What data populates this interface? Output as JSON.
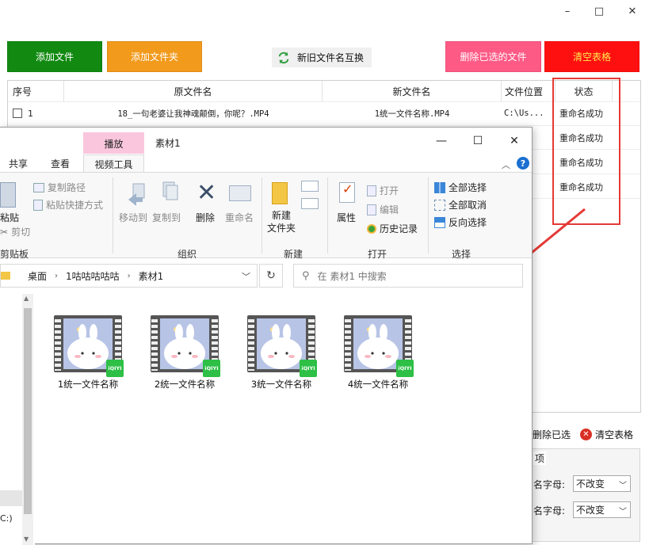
{
  "app": {
    "window_controls": {
      "minimize": "–",
      "maximize": "□",
      "close": "✕"
    },
    "toolbar": {
      "add_file": "添加文件",
      "add_folder": "添加文件夹",
      "swap_names": "新旧文件名互换",
      "delete_selected": "删除已选的文件",
      "clear_table": "清空表格"
    },
    "colors": {
      "add_file": "#128a12",
      "add_folder": "#f29a1c",
      "delete_selected": "#fe5a86",
      "clear_table": "#ff1010",
      "highlight": "#e53935",
      "arrow": "#e53935"
    },
    "table": {
      "headers": [
        "序号",
        "原文件名",
        "新文件名",
        "文件位置",
        "状态"
      ],
      "rows": [
        {
          "index": "1",
          "old_name": "18_一句老婆让我神魂颠倒，你呢？.MP4",
          "new_name": "1统一文件名称.MP4",
          "location": "C:\\Us...",
          "status": "重命名成功"
        },
        {
          "index": "",
          "old_name": "",
          "new_name": "",
          "location": "",
          "status": "重命名成功"
        },
        {
          "index": "",
          "old_name": "",
          "new_name": "",
          "location": "",
          "status": "重命名成功"
        },
        {
          "index": "",
          "old_name": "",
          "new_name": "",
          "location": "",
          "status": "重命名成功"
        }
      ]
    },
    "bottom": {
      "delete_selected": "删除已选",
      "clear_table": "清空表格",
      "options_title": "项",
      "option1_label": "名字母:",
      "option1_value": "不改变",
      "option2_label": "名字母:",
      "option2_value": "不改变"
    }
  },
  "explorer": {
    "title": "素材1",
    "contextual_tab_header": "播放",
    "tabs": [
      "共享",
      "查看",
      "视频工具"
    ],
    "window_controls": {
      "minimize": "—",
      "maximize": "☐",
      "close": "✕"
    },
    "ribbon": {
      "paste": "粘贴",
      "copy_path": "复制路径",
      "paste_shortcut": "粘贴快捷方式",
      "cut": "剪切",
      "clipboard_group": "剪贴板",
      "move_to": "移动到",
      "copy_to": "复制到",
      "delete": "删除",
      "rename": "重命名",
      "organize_group": "组织",
      "new_folder": "新建\n文件夹",
      "new_folder_line1": "新建",
      "new_folder_line2": "文件夹",
      "new_group": "新建",
      "properties": "属性",
      "open": "打开",
      "edit": "编辑",
      "history": "历史记录",
      "open_group": "打开",
      "select_all": "全部选择",
      "select_none": "全部取消",
      "invert_selection": "反向选择",
      "select_group": "选择"
    },
    "address": {
      "crumbs": [
        "桌面",
        "1咕咕咕咕咕",
        "素材1"
      ]
    },
    "search_placeholder": "在 素材1 中搜索",
    "nav_drive": "C:)",
    "files": [
      {
        "name": "1统一文件名称",
        "badge": "iQIYI"
      },
      {
        "name": "2统一文件名称",
        "badge": "iQIYI"
      },
      {
        "name": "3统一文件名称",
        "badge": "iQIYI"
      },
      {
        "name": "4统一文件名称",
        "badge": "iQIYI"
      }
    ]
  }
}
